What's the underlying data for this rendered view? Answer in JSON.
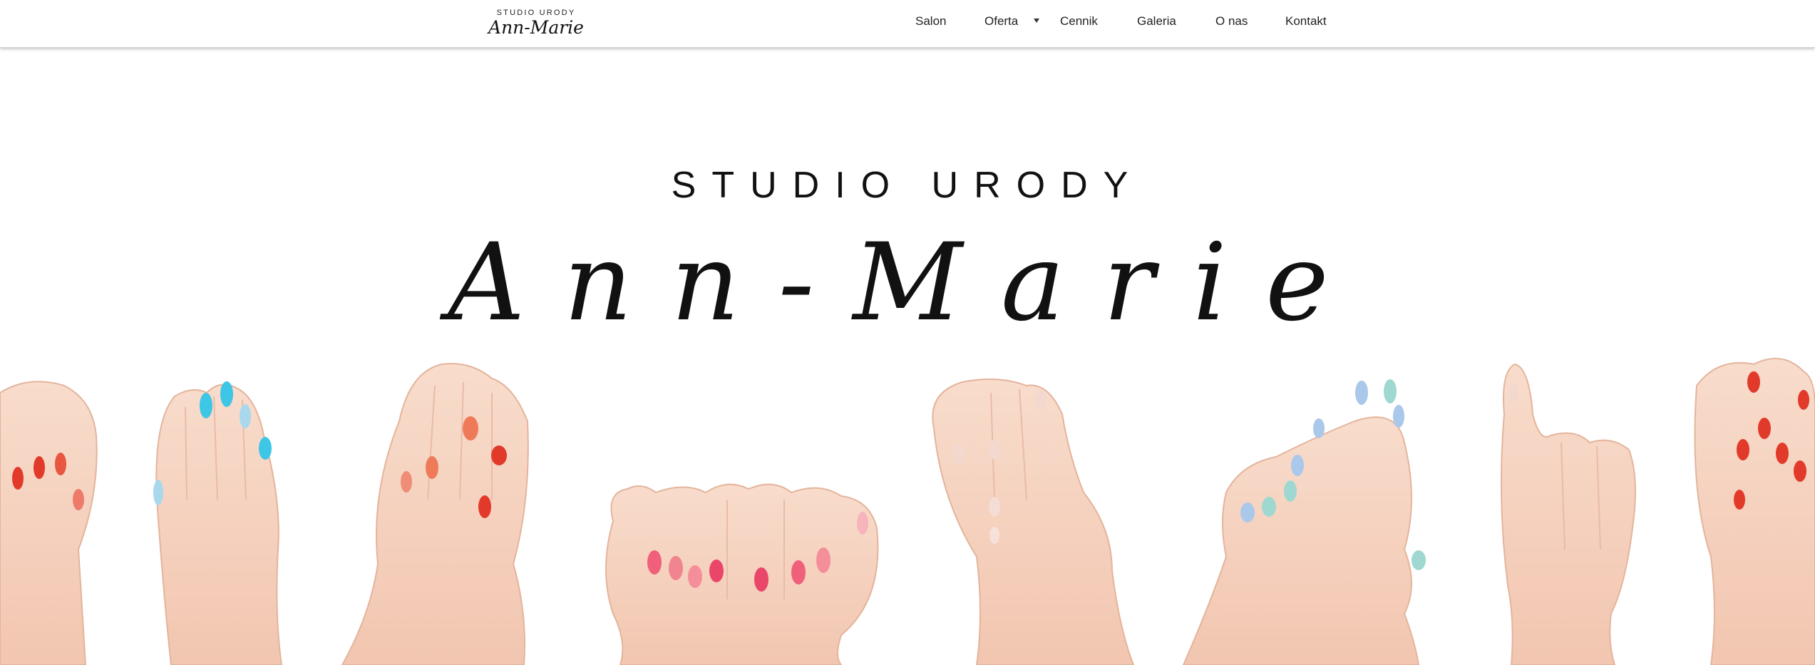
{
  "nav": {
    "logo_small": "STUDIO URODY",
    "logo_script": "Ann-Marie",
    "items": [
      {
        "label": "Salon"
      },
      {
        "label": "Oferta"
      },
      {
        "label": "Cennik"
      },
      {
        "label": "Galeria"
      },
      {
        "label": "O nas"
      },
      {
        "label": "Kontakt"
      }
    ]
  },
  "hero": {
    "title_small": "STUDIO URODY",
    "title_script": "Ann-Marie"
  },
  "colors": {
    "skin": "#f6d2bf",
    "skin_shadow": "#e9b9a2",
    "nail_cyan": "#3ec6e6",
    "nail_coral": "#ef7a5a",
    "nail_red": "#e23a2a",
    "nail_pink": "#f0607a",
    "nail_mint": "#9fd8d0",
    "nail_blue": "#a9c8ea",
    "nail_nude": "#f2d8cf"
  }
}
